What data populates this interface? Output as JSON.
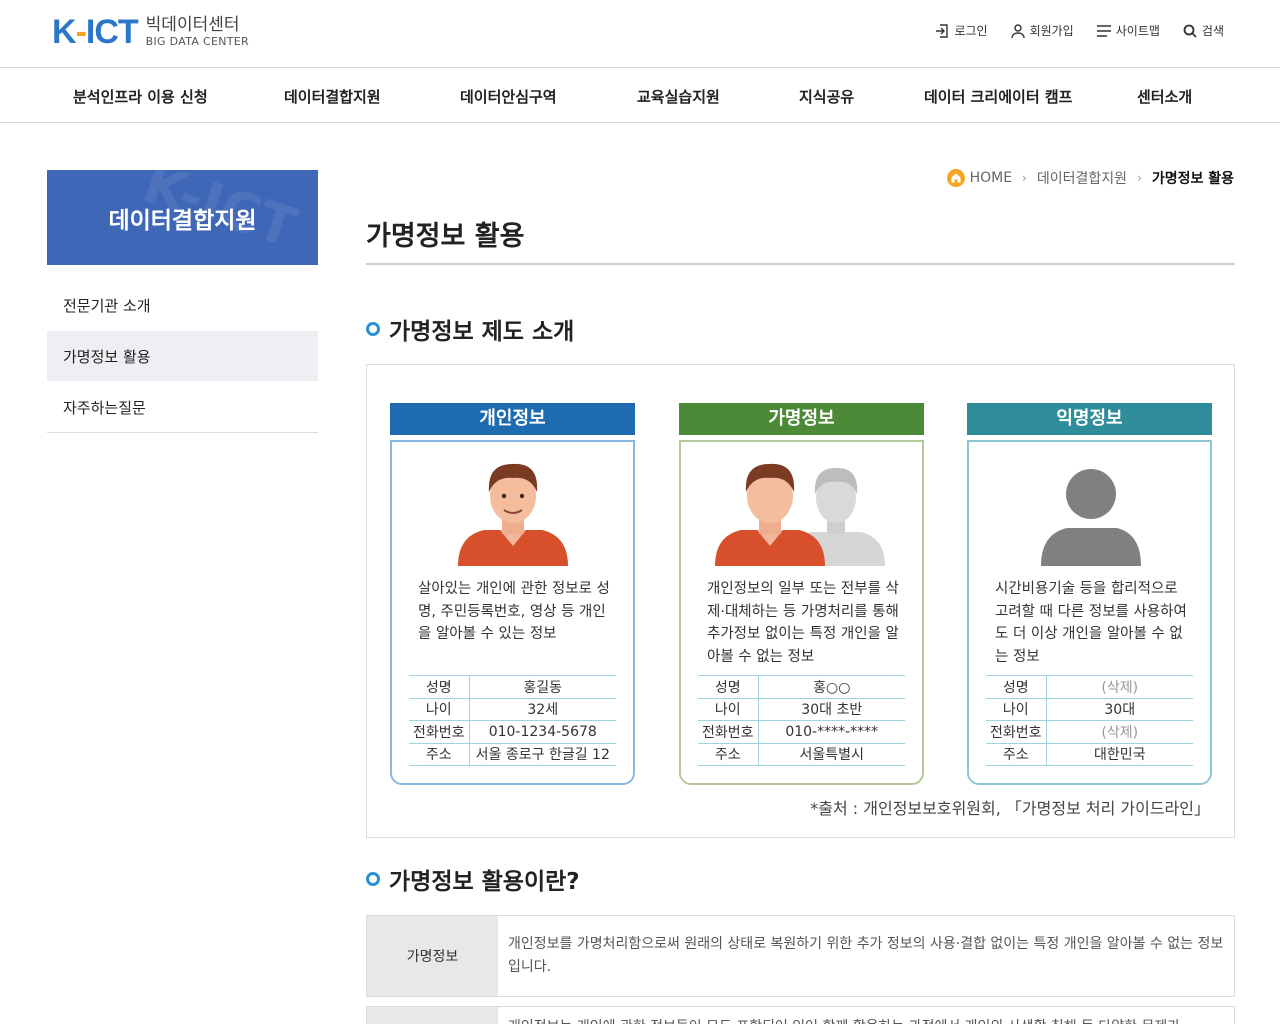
{
  "header": {
    "logo_mark_k": "K",
    "logo_mark_dash": "-",
    "logo_mark_ict": "ICT",
    "logo_ko": "빅데이터센터",
    "logo_en": "BIG DATA CENTER",
    "util": {
      "login": "로그인",
      "join": "회원가입",
      "sitemap": "사이트맵",
      "search": "검색"
    }
  },
  "gnb": [
    "분석인프라 이용 신청",
    "데이터결합지원",
    "데이터안심구역",
    "교육실습지원",
    "지식공유",
    "데이터 크리에이터 캠프",
    "센터소개"
  ],
  "sidebar": {
    "title": "데이터결합지원",
    "watermark": "K-ICT",
    "items": [
      "전문기관 소개",
      "가명정보 활용",
      "자주하는질문"
    ]
  },
  "breadcrumb": {
    "home": "HOME",
    "parent": "데이터결합지원",
    "current": "가명정보 활용"
  },
  "page_title": "가명정보 활용",
  "section1": {
    "title": "가명정보 제도 소개",
    "source": "*출처 : 개인정보보호위원회, 「가명정보 처리 가이드라인」",
    "cards": [
      {
        "title": "개인정보",
        "color": "#1f6bb0",
        "desc": "살아있는 개인에 관한 정보로 성명, 주민등록번호, 영상 등 개인을 알아볼 수 있는 정보",
        "rows": [
          {
            "k": "성명",
            "v": "홍길동"
          },
          {
            "k": "나이",
            "v": "32세"
          },
          {
            "k": "전화번호",
            "v": "010-1234-5678"
          },
          {
            "k": "주소",
            "v": "서울 종로구 한글길 12"
          }
        ]
      },
      {
        "title": "가명정보",
        "color": "#4c8a37",
        "desc": "개인정보의 일부 또는 전부를 삭제·대체하는 등 가명처리를 통해 추가정보 없이는 특정 개인을 알아볼 수 없는 정보",
        "rows": [
          {
            "k": "성명",
            "v": "홍○○"
          },
          {
            "k": "나이",
            "v": "30대 초반"
          },
          {
            "k": "전화번호",
            "v": "010-****-****"
          },
          {
            "k": "주소",
            "v": "서울특별시"
          }
        ]
      },
      {
        "title": "익명정보",
        "color": "#2f8c99",
        "desc": "시간비용기술 등을 합리적으로 고려할 때 다른 정보를 사용하여도 더 이상 개인을 알아볼 수 없는 정보",
        "rows": [
          {
            "k": "성명",
            "v": "(삭제)"
          },
          {
            "k": "나이",
            "v": "30대"
          },
          {
            "k": "전화번호",
            "v": "(삭제)"
          },
          {
            "k": "주소",
            "v": "대한민국"
          }
        ]
      }
    ]
  },
  "section2": {
    "title": "가명정보 활용이란?",
    "rows": [
      {
        "key": "가명정보",
        "value": "개인정보를 가명처리함으로써 원래의 상태로 복원하기 위한 추가 정보의 사용·결합 없이는 특정 개인을 알아볼 수 없는 정보입니다."
      },
      {
        "key": "",
        "value": "개인정보는 개인에 관한 정보들이 모두 포함되어 있어 함께 활용하는 과정에서 개인의 사생활 침해 등 다양한 문제가"
      }
    ]
  }
}
